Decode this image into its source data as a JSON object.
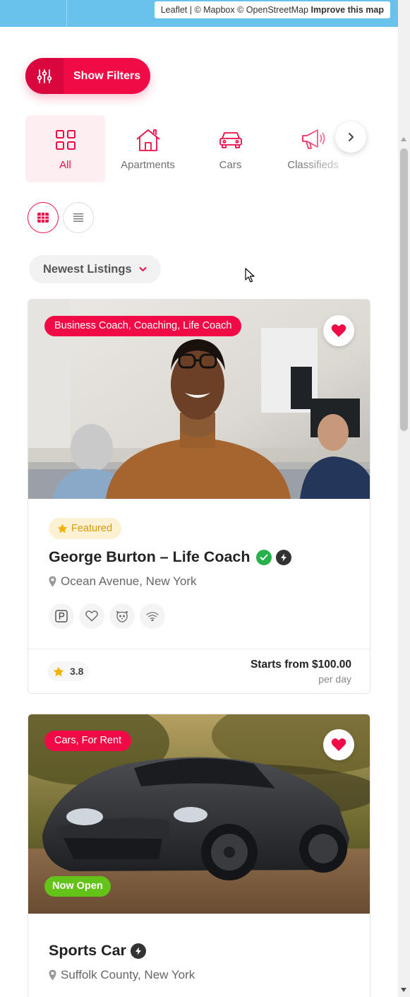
{
  "map": {
    "attribution_leaflet": "Leaflet",
    "attribution_rest": " | © Mapbox © OpenStreetMap ",
    "attribution_link": "Improve this map"
  },
  "filters": {
    "label": "Show Filters"
  },
  "categories": [
    {
      "label": "All",
      "icon": "grid-icon",
      "active": true
    },
    {
      "label": "Apartments",
      "icon": "house-icon",
      "active": false
    },
    {
      "label": "Cars",
      "icon": "car-icon",
      "active": false
    },
    {
      "label": "Classifieds",
      "icon": "megaphone-icon",
      "active": false
    }
  ],
  "view_modes": [
    "grid",
    "list"
  ],
  "sort": {
    "selected": "Newest Listings"
  },
  "listings": [
    {
      "tag": "Business Coach, Coaching, Life Coach",
      "featured": "Featured",
      "title": "George Burton – Life Coach",
      "location": "Ocean Avenue, New York",
      "amenities": [
        "parking-icon",
        "heart-icon",
        "pet-icon",
        "wifi-icon"
      ],
      "rating": "3.8",
      "price": "Starts from $100.00",
      "price_unit": "per day"
    },
    {
      "tag": "Cars, For Rent",
      "status": "Now Open",
      "title": "Sports Car",
      "location": "Suffolk County, New York"
    }
  ],
  "colors": {
    "accent": "#f10b46",
    "map": "#69c2ec",
    "open": "#63c318",
    "featured_bg": "#fdf1d3",
    "featured_text": "#d19b0a",
    "verified": "#27b04b"
  }
}
